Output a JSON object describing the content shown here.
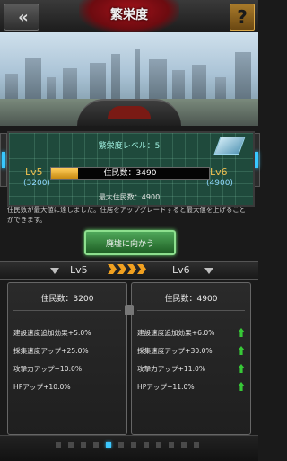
{
  "header": {
    "title": "繁栄度",
    "help_label": "?",
    "back_label": "«"
  },
  "panel": {
    "level_title": "繁栄度レベル：5",
    "current_level": "Lv5",
    "current_threshold": "(3200)",
    "next_level": "Lv6",
    "next_threshold": "(4900)",
    "residents_label": "住民数：3490",
    "progress_fraction": 0.17,
    "max_residents_label": "最大住民数：4900"
  },
  "note": "住民数が最大値に達しました。住居をアップグレードすると最大値を上げることができます。",
  "go_button_label": "廃墟に向かう",
  "compare": {
    "left_level": "Lv5",
    "right_level": "Lv6",
    "left": {
      "population": "住民数：3200",
      "stats": [
        "建設速度追加効果+5.0%",
        "採集速度アップ+25.0%",
        "攻撃力アップ+10.0%",
        "HPアップ+10.0%"
      ]
    },
    "right": {
      "population": "住民数：4900",
      "stats": [
        "建設速度追加効果+6.0%",
        "採集速度アップ+30.0%",
        "攻撃力アップ+11.0%",
        "HPアップ+11.0%"
      ]
    }
  },
  "colors": {
    "accent_gold": "#f0c050",
    "up_arrow": "#37c837",
    "panel_green": "#1f4a3c",
    "button_green": "#4fa85a"
  }
}
